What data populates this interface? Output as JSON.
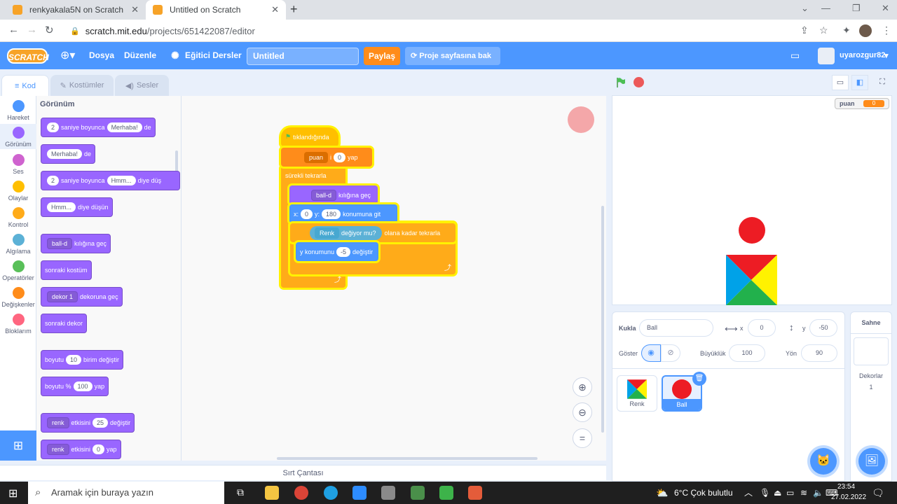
{
  "browser": {
    "tabs": [
      {
        "title": "renkyakala5N on Scratch",
        "active": false
      },
      {
        "title": "Untitled on Scratch",
        "active": true
      }
    ],
    "url_domain": "scratch.mit.edu",
    "url_path": "/projects/651422087/editor",
    "new_tab": "+",
    "minimize": "⌄",
    "restore": "—",
    "max": "❐",
    "close": "✕"
  },
  "menu": {
    "logo": "SCRATCH",
    "file": "Dosya",
    "edit": "Düzenle",
    "tutorials": "Eğitici Dersler",
    "project_title": "Untitled",
    "share": "Paylaş",
    "project_page": "Proje sayfasına bak",
    "username": "uyarozgur82"
  },
  "editor_tabs": {
    "code": "Kod",
    "costumes": "Kostümler",
    "sounds": "Sesler"
  },
  "categories": [
    {
      "label": "Hareket",
      "color": "#4c97ff"
    },
    {
      "label": "Görünüm",
      "color": "#9966ff"
    },
    {
      "label": "Ses",
      "color": "#cf63cf"
    },
    {
      "label": "Olaylar",
      "color": "#ffbf00"
    },
    {
      "label": "Kontrol",
      "color": "#ffab19"
    },
    {
      "label": "Algılama",
      "color": "#5cb1d6"
    },
    {
      "label": "Operatörler",
      "color": "#59c059"
    },
    {
      "label": "Değişkenler",
      "color": "#ff8c1a"
    },
    {
      "label": "Bloklarım",
      "color": "#ff6680"
    }
  ],
  "palette": {
    "heading": "Görünüm",
    "b1": {
      "n": "2",
      "t1": "saniye boyunca",
      "v": "Merhaba!",
      "t2": "de"
    },
    "b2": {
      "v": "Merhaba!",
      "t": "de"
    },
    "b3": {
      "n": "2",
      "t1": "saniye boyunca",
      "v": "Hmm...",
      "t2": "diye düş"
    },
    "b4": {
      "v": "Hmm...",
      "t": "diye düşün"
    },
    "b5": {
      "d": "ball-d",
      "t": "kılığına geç"
    },
    "b6": {
      "t": "sonraki kostüm"
    },
    "b7": {
      "d": "dekor 1",
      "t": "dekoruna geç"
    },
    "b8": {
      "t": "sonraki dekor"
    },
    "b9": {
      "t1": "boyutu",
      "n": "10",
      "t2": "birim değiştir"
    },
    "b10": {
      "t1": "boyutu %",
      "n": "100",
      "t2": "yap"
    },
    "b11": {
      "d": "renk",
      "t1": "etkisini",
      "n": "25",
      "t2": "değiştir"
    },
    "b12": {
      "d": "renk",
      "t1": "etkisini",
      "n": "0",
      "t2": "yap"
    }
  },
  "script": {
    "hat": "tıklandığında",
    "set_var": {
      "d": "puan",
      "t1": "i",
      "n": "0",
      "t2": "yap"
    },
    "forever": "sürekli tekrarla",
    "switch": {
      "d": "ball-d",
      "t": "kılığına geç"
    },
    "goto": {
      "x_label": "x:",
      "x": "0",
      "y_label": "y:",
      "y": "180",
      "t": "konumuna git"
    },
    "repeat_until": {
      "d": "Renk",
      "sensing": "değiyor mu?",
      "t": "olana kadar tekrarla"
    },
    "change_y": {
      "t1": "y konumunu",
      "n": "-5",
      "t2": "değiştir"
    }
  },
  "backpack": "Sırt Çantası",
  "stage": {
    "monitor_label": "puan",
    "monitor_value": "0"
  },
  "sprite_info": {
    "sprite_label": "Kukla",
    "sprite_name": "Ball",
    "x_label": "x",
    "x_value": "0",
    "y_label": "y",
    "y_value": "-50",
    "show_label": "Göster",
    "size_label": "Büyüklük",
    "size_value": "100",
    "direction_label": "Yön",
    "direction_value": "90"
  },
  "sprites": [
    {
      "name": "Renk",
      "selected": false
    },
    {
      "name": "Ball",
      "selected": true
    }
  ],
  "stage_pane": {
    "title": "Sahne",
    "backdrops_label": "Dekorlar",
    "backdrops_count": "1"
  },
  "taskbar": {
    "search_placeholder": "Aramak için buraya yazın",
    "weather": "6°C  Çok bulutlu",
    "time": "23:54",
    "date": "27.02.2022"
  }
}
